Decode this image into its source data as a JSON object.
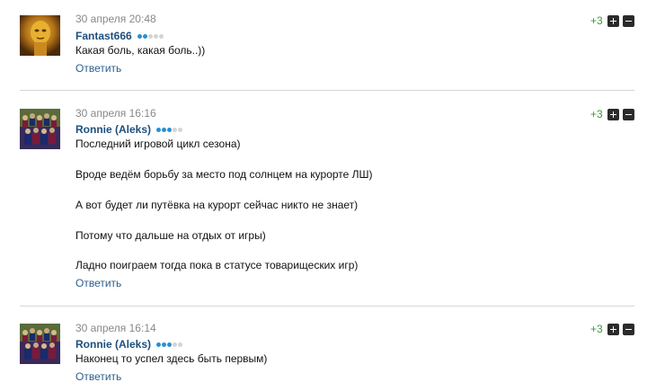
{
  "comments": [
    {
      "date": "30 апреля 20:48",
      "author": "Fantast666",
      "rank_level": 2,
      "rank_max": 5,
      "rating": "+3",
      "avatar_icon": "golden-head-avatar",
      "lines": [
        "Какая боль, какая боль..))"
      ],
      "reply_label": "Ответить"
    },
    {
      "date": "30 апреля 16:16",
      "author": "Ronnie (Aleks)",
      "rank_level": 3,
      "rank_max": 5,
      "rating": "+3",
      "avatar_icon": "team-photo-avatar",
      "lines": [
        "Последний игровой цикл сезона)",
        "Вроде ведём борьбу за место под солнцем на курорте ЛШ)",
        "А вот будет ли путёвка на курорт сейчас никто не знает)",
        "Потому что дальше на отдых от игры)",
        "Ладно поиграем тогда пока в статусе товарищеских игр)"
      ],
      "reply_label": "Ответить"
    },
    {
      "date": "30 апреля 16:14",
      "author": "Ronnie (Aleks)",
      "rank_level": 3,
      "rank_max": 5,
      "rating": "+3",
      "avatar_icon": "team-photo-avatar",
      "lines": [
        "Наконец то успел здесь быть первым)"
      ],
      "reply_label": "Ответить"
    }
  ],
  "colors": {
    "author": "#1d4f7c",
    "reply": "#2b5f8e",
    "rating": "#3a9a3a",
    "rank_on": "#2a8fd0",
    "rank_off": "#d4d4d4"
  }
}
